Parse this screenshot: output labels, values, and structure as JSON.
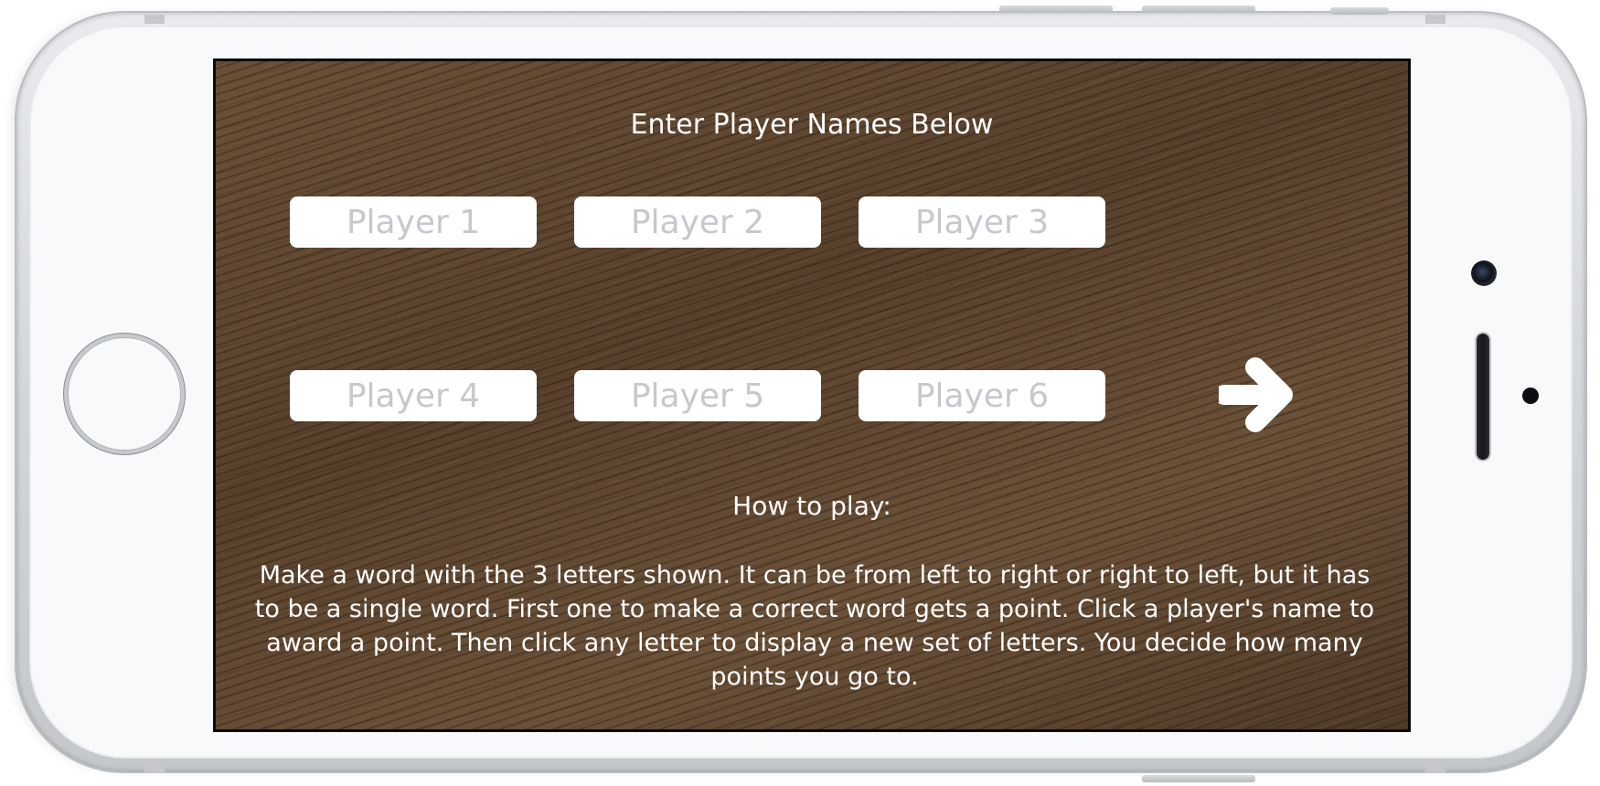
{
  "screen": {
    "title": "Enter Player Names Below",
    "players": [
      {
        "placeholder": "Player 1"
      },
      {
        "placeholder": "Player 2"
      },
      {
        "placeholder": "Player 3"
      },
      {
        "placeholder": "Player 4"
      },
      {
        "placeholder": "Player 5"
      },
      {
        "placeholder": "Player 6"
      }
    ],
    "next_button_icon": "right-arrow-icon",
    "how_to_play": {
      "heading": "How to play:",
      "body": "Make a word with the 3 letters shown. It can be from left to right or right to left, but it has to be a single word. First one to make a correct word gets a point. Click a player's name to award a point. Then click any letter to display a new set of letters. You decide how many points you go to."
    }
  },
  "device": {
    "frame_color": "#f8f9fb",
    "screen_background": "wood-texture"
  }
}
